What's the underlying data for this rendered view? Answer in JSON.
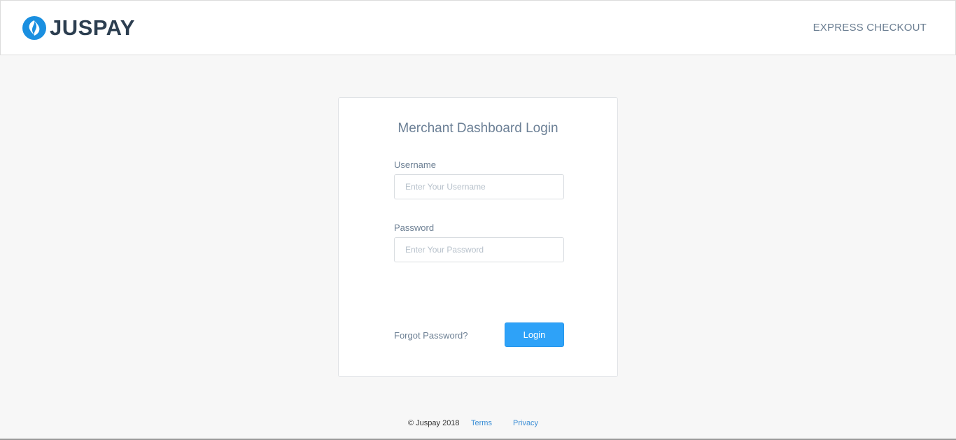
{
  "header": {
    "brand_text": "JUSPAY",
    "nav_link": "EXPRESS CHECKOUT",
    "brand_color": "#1a8fe0"
  },
  "login": {
    "title": "Merchant Dashboard Login",
    "username_label": "Username",
    "username_placeholder": "Enter Your Username",
    "password_label": "Password",
    "password_placeholder": "Enter Your Password",
    "forgot_label": "Forgot Password?",
    "login_label": "Login",
    "button_color": "#2ea2f8"
  },
  "footer": {
    "copyright": "© Juspay 2018",
    "terms": "Terms",
    "privacy": "Privacy"
  }
}
